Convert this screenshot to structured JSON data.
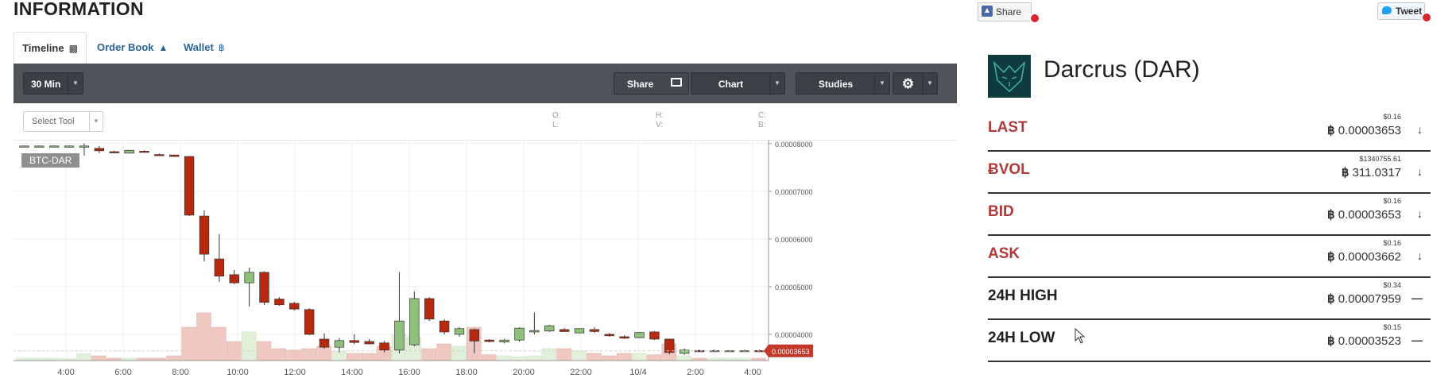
{
  "page": {
    "title": "INFORMATION"
  },
  "tabs": [
    {
      "label": "Timeline",
      "icon": "bar-chart-icon",
      "active": true
    },
    {
      "label": "Order Book",
      "icon": "area-chart-icon",
      "active": false
    },
    {
      "label": "Wallet",
      "icon": "bitcoin-icon",
      "active": false
    }
  ],
  "toolbar": {
    "interval": "30 Min",
    "share_label": "Share",
    "chart_label": "Chart",
    "studies_label": "Studies"
  },
  "subbar": {
    "select_tool_placeholder": "Select Tool",
    "ohlc": {
      "o": "O:",
      "l": "L:",
      "h": "H:",
      "v": "V:",
      "c": "C:",
      "b": "B:"
    }
  },
  "chart_data": {
    "type": "candlestick",
    "symbol": "BTC-DAR",
    "x_ticks": [
      "4:00",
      "6:00",
      "8:00",
      "10:00",
      "12:00",
      "14:00",
      "16:00",
      "18:00",
      "20:00",
      "22:00",
      "10/4",
      "2:00",
      "4:00"
    ],
    "y_ticks": [
      "0.00004000",
      "0.00005000",
      "0.00006000",
      "0.00007000",
      "0.00008000"
    ],
    "ylim": [
      3.45e-05,
      8.08e-05
    ],
    "current_price": "0.00003653",
    "colors": {
      "up": "#8ec07c",
      "down": "#b7290f",
      "volume_up": "#e2f0da",
      "volume_down": "#f0c8c2",
      "price_tag": "#c0392b"
    },
    "candles": [
      {
        "o": 7.95e-05,
        "h": 7.96e-05,
        "l": 7.94e-05,
        "c": 7.95e-05
      },
      {
        "o": 7.95e-05,
        "h": 7.96e-05,
        "l": 7.94e-05,
        "c": 7.95e-05
      },
      {
        "o": 7.95e-05,
        "h": 7.96e-05,
        "l": 7.94e-05,
        "c": 7.95e-05
      },
      {
        "o": 7.95e-05,
        "h": 7.96e-05,
        "l": 7.94e-05,
        "c": 7.95e-05
      },
      {
        "o": 7.95e-05,
        "h": 8e-05,
        "l": 7.75e-05,
        "c": 7.95e-05
      },
      {
        "o": 7.9e-05,
        "h": 7.95e-05,
        "l": 7.8e-05,
        "c": 7.85e-05
      },
      {
        "o": 7.83e-05,
        "h": 7.85e-05,
        "l": 7.8e-05,
        "c": 7.82e-05
      },
      {
        "o": 7.8e-05,
        "h": 7.87e-05,
        "l": 7.79e-05,
        "c": 7.86e-05
      },
      {
        "o": 7.84e-05,
        "h": 7.86e-05,
        "l": 7.81e-05,
        "c": 7.82e-05
      },
      {
        "o": 7.77e-05,
        "h": 7.79e-05,
        "l": 7.75e-05,
        "c": 7.76e-05
      },
      {
        "o": 7.76e-05,
        "h": 7.77e-05,
        "l": 7.72e-05,
        "c": 7.73e-05
      },
      {
        "o": 7.73e-05,
        "h": 7.74e-05,
        "l": 6.48e-05,
        "c": 6.5e-05
      },
      {
        "o": 6.48e-05,
        "h": 6.6e-05,
        "l": 5.53e-05,
        "c": 5.68e-05
      },
      {
        "o": 5.58e-05,
        "h": 6.1e-05,
        "l": 5.1e-05,
        "c": 5.22e-05
      },
      {
        "o": 5.25e-05,
        "h": 5.35e-05,
        "l": 5.05e-05,
        "c": 5.08e-05
      },
      {
        "o": 5.08e-05,
        "h": 5.4e-05,
        "l": 4.58e-05,
        "c": 5.3e-05
      },
      {
        "o": 5.3e-05,
        "h": 5.32e-05,
        "l": 4.62e-05,
        "c": 4.67e-05
      },
      {
        "o": 4.74e-05,
        "h": 4.78e-05,
        "l": 4.6e-05,
        "c": 4.62e-05
      },
      {
        "o": 4.65e-05,
        "h": 4.68e-05,
        "l": 4.5e-05,
        "c": 4.53e-05
      },
      {
        "o": 4.52e-05,
        "h": 4.55e-05,
        "l": 3.98e-05,
        "c": 4e-05
      },
      {
        "o": 3.9e-05,
        "h": 4.02e-05,
        "l": 3.7e-05,
        "c": 3.73e-05
      },
      {
        "o": 3.73e-05,
        "h": 3.92e-05,
        "l": 3.62e-05,
        "c": 3.87e-05
      },
      {
        "o": 3.87e-05,
        "h": 4e-05,
        "l": 3.79e-05,
        "c": 3.83e-05
      },
      {
        "o": 3.85e-05,
        "h": 3.9e-05,
        "l": 3.79e-05,
        "c": 3.8e-05
      },
      {
        "o": 3.82e-05,
        "h": 3.86e-05,
        "l": 3.62e-05,
        "c": 3.67e-05
      },
      {
        "o": 3.67e-05,
        "h": 5.3e-05,
        "l": 3.6e-05,
        "c": 4.28e-05
      },
      {
        "o": 3.78e-05,
        "h": 4.9e-05,
        "l": 3.75e-05,
        "c": 4.75e-05
      },
      {
        "o": 4.75e-05,
        "h": 4.78e-05,
        "l": 4.28e-05,
        "c": 4.32e-05
      },
      {
        "o": 4.28e-05,
        "h": 4.32e-05,
        "l": 4e-05,
        "c": 4.05e-05
      },
      {
        "o": 4e-05,
        "h": 4.15e-05,
        "l": 3.95e-05,
        "c": 4.12e-05
      },
      {
        "o": 4.1e-05,
        "h": 4.12e-05,
        "l": 3.6e-05,
        "c": 3.86e-05
      },
      {
        "o": 3.88e-05,
        "h": 3.9e-05,
        "l": 3.83e-05,
        "c": 3.85e-05
      },
      {
        "o": 3.84e-05,
        "h": 3.9e-05,
        "l": 3.81e-05,
        "c": 3.88e-05
      },
      {
        "o": 3.88e-05,
        "h": 4.15e-05,
        "l": 3.85e-05,
        "c": 4.13e-05
      },
      {
        "o": 4.05e-05,
        "h": 4.46e-05,
        "l": 4e-05,
        "c": 4.08e-05
      },
      {
        "o": 4.07e-05,
        "h": 4.2e-05,
        "l": 4.05e-05,
        "c": 4.18e-05
      },
      {
        "o": 4.1e-05,
        "h": 4.13e-05,
        "l": 4.05e-05,
        "c": 4.06e-05
      },
      {
        "o": 4.03e-05,
        "h": 4.13e-05,
        "l": 4.02e-05,
        "c": 4.12e-05
      },
      {
        "o": 4.1e-05,
        "h": 4.15e-05,
        "l": 4.03e-05,
        "c": 4.06e-05
      },
      {
        "o": 4e-05,
        "h": 4.03e-05,
        "l": 3.95e-05,
        "c": 3.97e-05
      },
      {
        "o": 3.95e-05,
        "h": 3.98e-05,
        "l": 3.9e-05,
        "c": 3.92e-05
      },
      {
        "o": 3.93e-05,
        "h": 4.05e-05,
        "l": 3.92e-05,
        "c": 4.04e-05
      },
      {
        "o": 4.05e-05,
        "h": 4.07e-05,
        "l": 3.88e-05,
        "c": 3.9e-05
      },
      {
        "o": 3.9e-05,
        "h": 3.91e-05,
        "l": 3.58e-05,
        "c": 3.62e-05
      },
      {
        "o": 3.6e-05,
        "h": 3.7e-05,
        "l": 3.57e-05,
        "c": 3.67e-05
      },
      {
        "o": 3.66e-05,
        "h": 3.68e-05,
        "l": 3.64e-05,
        "c": 3.65e-05
      },
      {
        "o": 3.65e-05,
        "h": 3.68e-05,
        "l": 3.64e-05,
        "c": 3.66e-05
      },
      {
        "o": 3.65e-05,
        "h": 3.67e-05,
        "l": 3.64e-05,
        "c": 3.66e-05
      },
      {
        "o": 3.66e-05,
        "h": 3.68e-05,
        "l": 3.65e-05,
        "c": 3.66e-05
      },
      {
        "o": 3.66e-05,
        "h": 3.68e-05,
        "l": 3.64e-05,
        "c": 3.65e-05
      }
    ],
    "volumes": [
      0.05,
      0.05,
      0.05,
      0.04,
      0.14,
      0.1,
      0.05,
      0.05,
      0.05,
      0.05,
      0.1,
      0.7,
      1.0,
      0.7,
      0.4,
      0.6,
      0.4,
      0.25,
      0.22,
      0.25,
      0.3,
      0.2,
      0.15,
      0.15,
      0.3,
      0.55,
      0.5,
      0.25,
      0.35,
      0.3,
      0.7,
      0.12,
      0.1,
      0.08,
      0.1,
      0.25,
      0.25,
      0.2,
      0.15,
      0.1,
      0.15,
      0.15,
      0.12,
      0.35,
      0.1,
      0.05,
      0.05,
      0.05,
      0.05,
      0.05
    ]
  },
  "social": {
    "share_label": "Share",
    "tweet_label": "Tweet"
  },
  "market": {
    "name": "Darcrus (DAR)",
    "rows": [
      {
        "label": "LAST",
        "usd": "$0.16",
        "btc": "0.00003653",
        "trend": "down",
        "style": "red"
      },
      {
        "label": "ɃVOL",
        "usd": "$1340755.61",
        "btc": "311.0317",
        "trend": "down",
        "style": "red"
      },
      {
        "label": "BID",
        "usd": "$0.16",
        "btc": "0.00003653",
        "trend": "down",
        "style": "red"
      },
      {
        "label": "ASK",
        "usd": "$0.16",
        "btc": "0.00003662",
        "trend": "down",
        "style": "red"
      },
      {
        "label": "24H HIGH",
        "usd": "$0.34",
        "btc": "0.00007959",
        "trend": "flat",
        "style": "dark"
      },
      {
        "label": "24H LOW",
        "usd": "$0.15",
        "btc": "0.00003523",
        "trend": "flat",
        "style": "dark"
      }
    ]
  }
}
